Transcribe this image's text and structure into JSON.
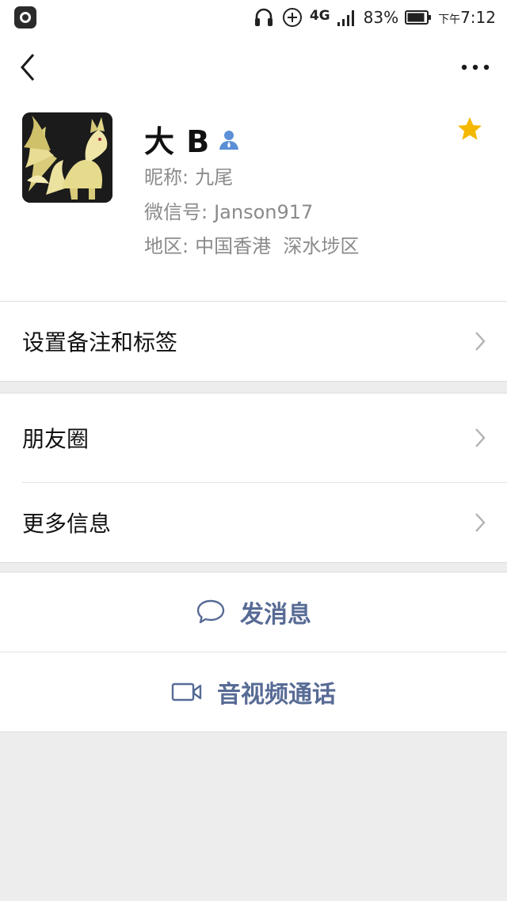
{
  "status_bar": {
    "battery_percent": "83%",
    "network": "4G",
    "time_prefix": "下午",
    "time": "7:12",
    "icons": [
      "app-icon",
      "headset-icon",
      "plus-circle-icon",
      "signal-icon",
      "battery-icon"
    ]
  },
  "nav": {
    "back_icon": "chevron-left-icon",
    "more_icon": "ellipsis-icon"
  },
  "profile": {
    "name": "大 B",
    "nickname_label": "昵称:",
    "nickname": "九尾",
    "wechat_id_label": "微信号:",
    "wechat_id": "Janson917",
    "region_label": "地区:",
    "region": "中国香港  深水埗区",
    "star_color": "#f5b800",
    "contact_badge_color": "#5b8fd6"
  },
  "menu": {
    "remark_tags": "设置备注和标签",
    "moments": "朋友圈",
    "more_info": "更多信息"
  },
  "actions": {
    "send_message": "发消息",
    "video_call": "音视频通话",
    "accent_color": "#576b95"
  }
}
